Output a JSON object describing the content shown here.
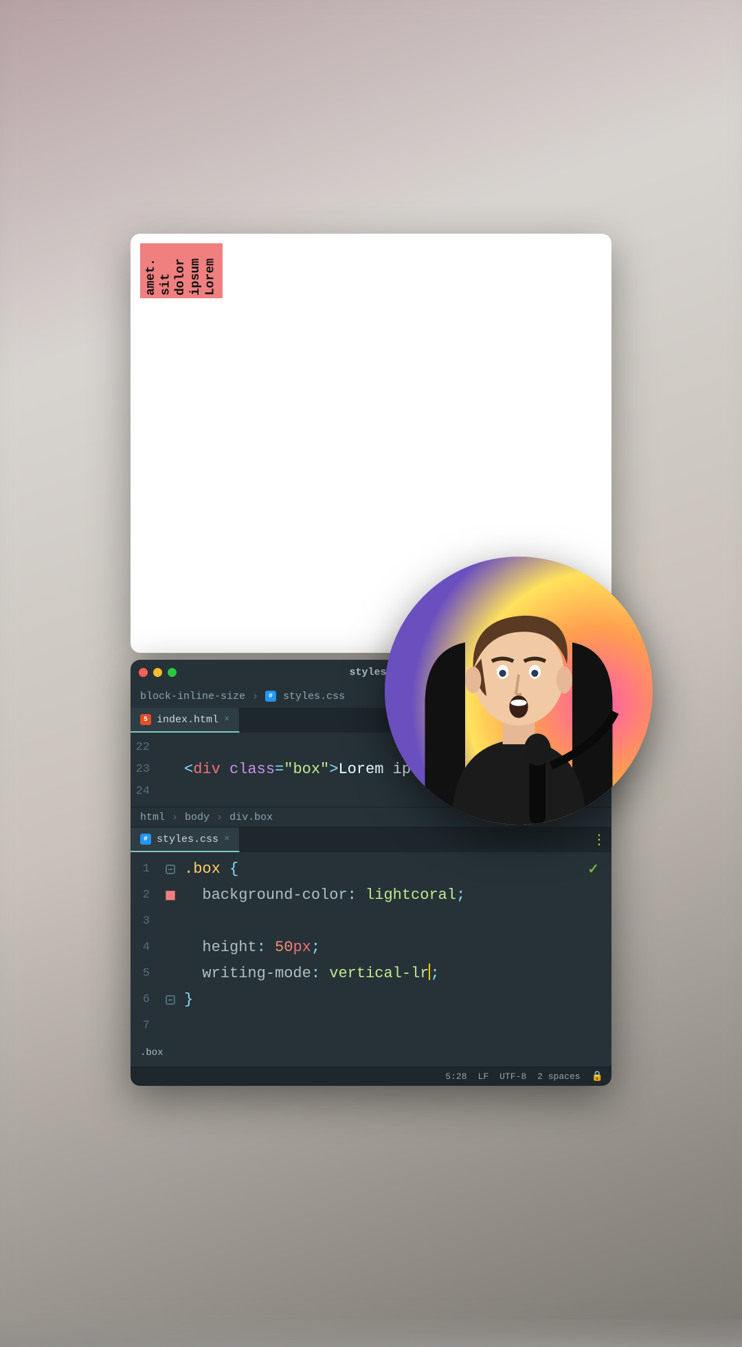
{
  "preview": {
    "box_text": "Lorem ipsum dolor sit amet."
  },
  "editor": {
    "window_title": "styles.",
    "breadcrumb1": {
      "project": "block-inline-size",
      "file": "styles.css"
    },
    "html_tab": {
      "label": "index.html"
    },
    "html_code": {
      "ln_before": "22",
      "ln": "23",
      "ln_after": "24",
      "tag_open": "div",
      "attr_name": "class",
      "attr_val": "box",
      "text": "Lorem ip"
    },
    "breadcrumb2": [
      "html",
      "body",
      "div.box"
    ],
    "css_tab": {
      "label": "styles.css"
    },
    "code": {
      "ln1": "1",
      "selector": ".box",
      "obrace": "{",
      "ln2": "2",
      "prop_bg": "background-color",
      "val_bg": "lightcoral",
      "ln3": "3",
      "ln4": "4",
      "prop_h": "height",
      "val_h_num": "50",
      "val_h_unit": "px",
      "ln5": "5",
      "prop_wm": "writing-mode",
      "val_wm": "vertical-lr",
      "ln6": "6",
      "cbrace": "}",
      "ln7": "7"
    },
    "sel_path": ".box",
    "status": {
      "pos": "5:28",
      "eol": "LF",
      "enc": "UTF-8",
      "indent": "2 spaces"
    }
  }
}
